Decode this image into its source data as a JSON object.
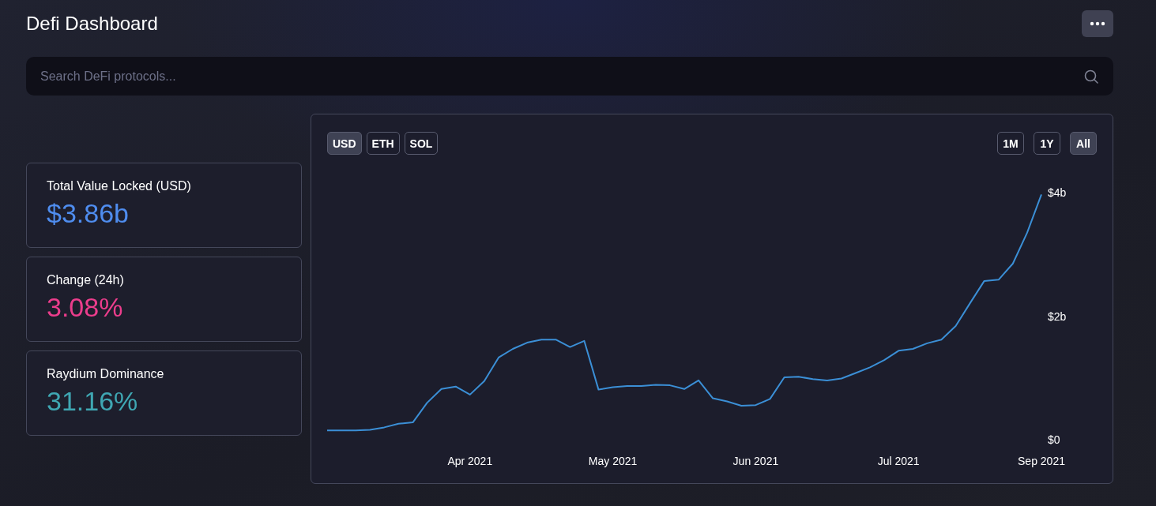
{
  "header": {
    "title": "Defi Dashboard"
  },
  "search": {
    "placeholder": "Search DeFi protocols..."
  },
  "stats": [
    {
      "label": "Total Value Locked (USD)",
      "value": "$3.86b",
      "color": "#4f8def"
    },
    {
      "label": "Change (24h)",
      "value": "3.08%",
      "color": "#ec3d8c"
    },
    {
      "label": "Raydium Dominance",
      "value": "31.16%",
      "color": "#3fa7b3"
    }
  ],
  "currency_tabs": [
    {
      "label": "USD",
      "selected": true
    },
    {
      "label": "ETH",
      "selected": false
    },
    {
      "label": "SOL",
      "selected": false
    }
  ],
  "range_tabs": [
    {
      "label": "1M",
      "selected": false
    },
    {
      "label": "1Y",
      "selected": false
    },
    {
      "label": "All",
      "selected": true
    }
  ],
  "chart": {
    "chart_data": {
      "type": "line",
      "categories": [
        null,
        null,
        null,
        null,
        null,
        null,
        null,
        null,
        null,
        null,
        "Apr 2021",
        null,
        null,
        null,
        null,
        null,
        null,
        null,
        null,
        null,
        "May 2021",
        null,
        null,
        null,
        null,
        null,
        null,
        null,
        null,
        null,
        "Jun 2021",
        null,
        null,
        null,
        null,
        null,
        null,
        null,
        null,
        null,
        "Jul 2021",
        null,
        null,
        null,
        null,
        null,
        null,
        null,
        null,
        null,
        "Sep 2021"
      ],
      "series": [
        {
          "color": "#3b8fd6",
          "values": [
            0.15,
            0.15,
            0.15,
            0.16,
            0.2,
            0.26,
            0.28,
            0.6,
            0.82,
            0.86,
            0.73,
            0.95,
            1.33,
            1.47,
            1.57,
            1.62,
            1.62,
            1.5,
            1.6,
            0.81,
            0.85,
            0.87,
            0.87,
            0.89,
            0.88,
            0.82,
            0.96,
            0.67,
            0.62,
            0.55,
            0.56,
            0.66,
            1.01,
            1.02,
            0.98,
            0.96,
            0.99,
            1.08,
            1.17,
            1.29,
            1.44,
            1.47,
            1.56,
            1.62,
            1.84,
            2.21,
            2.57,
            2.59,
            2.85,
            3.35,
            3.97
          ]
        }
      ],
      "ylim": [
        0,
        4
      ],
      "yticks": [
        {
          "value": 0,
          "label": "$0"
        },
        {
          "value": 2,
          "label": "$2b"
        },
        {
          "value": 4,
          "label": "$4b"
        }
      ]
    }
  }
}
